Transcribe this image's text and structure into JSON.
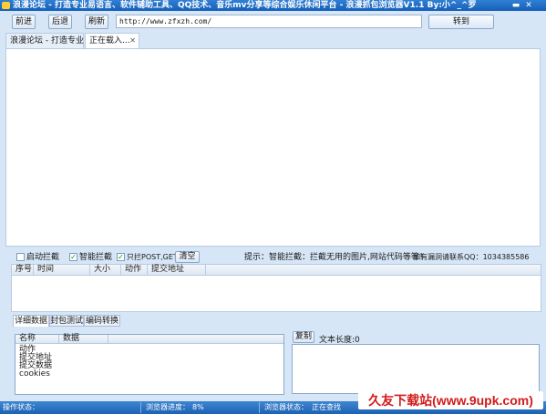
{
  "window": {
    "title": "浪漫论坛 - 打造专业易语言、软件辅助工具、QQ技术、音乐mv分享等综合娱乐休闲平台 - 浪漫抓包浏览器V1.1 By:小^_^罗"
  },
  "toolbar": {
    "back_label": "前进",
    "forward_label": "后退",
    "refresh_label": "刷新",
    "url_value": "http://www.zfxzh.com/",
    "go_label": "转到"
  },
  "tabs": [
    {
      "label": "浪漫论坛 - 打造专业"
    },
    {
      "label": "正在载入...",
      "close": "✕"
    }
  ],
  "capture": {
    "auto_block_label": "启动拦截",
    "auto_block_checked": false,
    "smart_block_label": "智能拦截",
    "smart_block_checked": true,
    "post_get_label": "只拦POST,GET",
    "post_get_checked": true,
    "clear_label": "清空",
    "tip": "提示：智能拦截：拦截无用的图片,网站代码等等！",
    "contact": "如有漏洞请联系QQ：1034385586"
  },
  "packet_table": {
    "columns": [
      "序号",
      "时间",
      "大小",
      "动作",
      "提交地址"
    ]
  },
  "detail_tabs": [
    {
      "label": "详细数据"
    },
    {
      "label": "封包测试"
    },
    {
      "label": "编码转换"
    }
  ],
  "detail_table": {
    "columns": [
      "名称",
      "数据"
    ],
    "rows": [
      "动作",
      "提交地址",
      "提交数据",
      "cookies"
    ]
  },
  "text_panel": {
    "copy_label": "复制",
    "length_label": "文本长度:0"
  },
  "status": {
    "op_state_label": "操作状态：",
    "progress_label": "浏览器进度：",
    "progress_value": "8%",
    "browser_state_label": "浏览器状态：",
    "browser_state_value": "正在查找"
  },
  "watermark": "久友下载站(www.9upk.com)",
  "colors": {
    "titlebar": "#1a66c0",
    "statusbar": "#2a70c0",
    "background": "#d6e6f6",
    "check": "#1a8a1a",
    "watermark": "#d31a1a"
  }
}
